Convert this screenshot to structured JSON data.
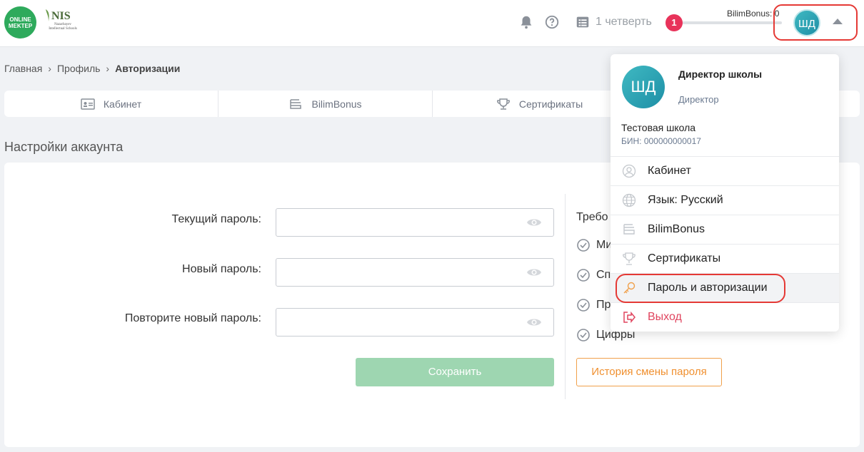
{
  "header": {
    "logo_online_mektep": "ONLINE MEKTEP",
    "logo_nis": "NIS",
    "logo_nis_sub": "Nazarbayev Intellectual Schools",
    "quarter": "1 четверть",
    "notification_count": "1",
    "bilimbonus_label": "BilimBonus: 0",
    "avatar_initials": "ШД"
  },
  "breadcrumb": {
    "home": "Главная",
    "profile": "Профиль",
    "current": "Авторизации"
  },
  "tabs": [
    {
      "label": "Кабинет",
      "icon": "id-card-icon"
    },
    {
      "label": "BilimBonus",
      "icon": "bilimbonus-icon"
    },
    {
      "label": "Сертификаты",
      "icon": "trophy-icon"
    }
  ],
  "section_title": "Настройки аккаунта",
  "form": {
    "current_password_label": "Текущий пароль:",
    "new_password_label": "Новый пароль:",
    "repeat_password_label": "Повторите новый пароль:",
    "current_password_value": "",
    "new_password_value": "",
    "repeat_password_value": "",
    "save_label": "Сохранить"
  },
  "requirements": {
    "title": "Требо",
    "items": [
      "Ми",
      "Сп",
      "Пр",
      "Цифры"
    ],
    "history_button": "История смены пароля"
  },
  "dropdown": {
    "avatar_initials": "ШД",
    "name": "Директор школы",
    "role": "Директор",
    "school": "Тестовая школа",
    "bin": "БИН: 000000000017",
    "items": [
      {
        "label": "Кабинет",
        "icon": "user-circle-icon"
      },
      {
        "label": "Язык: Русский",
        "icon": "globe-icon"
      },
      {
        "label": "BilimBonus",
        "icon": "bilimbonus-icon"
      },
      {
        "label": "Сертификаты",
        "icon": "trophy-icon"
      },
      {
        "label": "Пароль и авторизации",
        "icon": "key-icon"
      },
      {
        "label": "Выход",
        "icon": "logout-icon"
      }
    ]
  },
  "colors": {
    "accent_green": "#2eaa5c",
    "save_button": "#9ed6b1",
    "history_button": "#f09030",
    "badge": "#e8335a",
    "highlight": "#e53935",
    "logout": "#e0455f"
  }
}
